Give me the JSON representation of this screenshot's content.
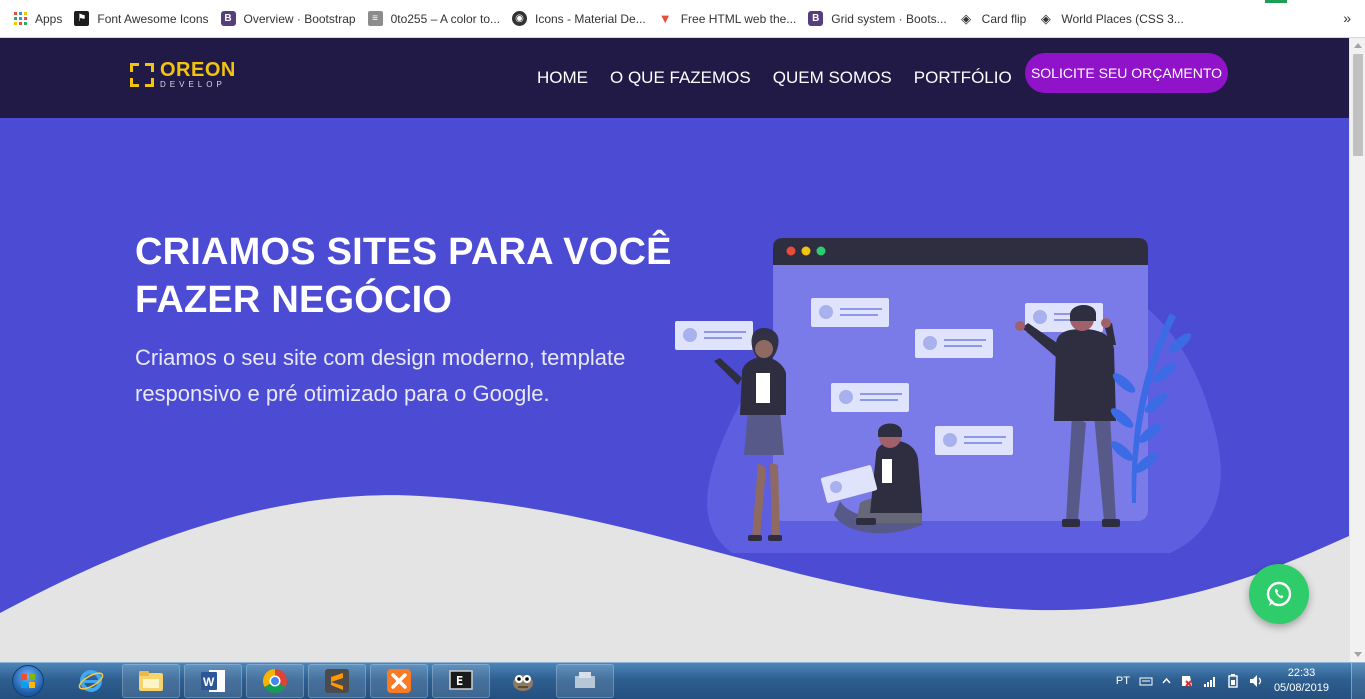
{
  "bookmarks": [
    {
      "label": "Apps",
      "icon": "apps-icon"
    },
    {
      "label": "Font Awesome Icons",
      "icon": "font-awesome-icon"
    },
    {
      "label": "Overview · Bootstrap",
      "icon": "bootstrap-icon"
    },
    {
      "label": "0to255 – A color to...",
      "icon": "page-icon"
    },
    {
      "label": "Icons - Material De...",
      "icon": "material-icon"
    },
    {
      "label": "Free HTML web the...",
      "icon": "free-html-icon"
    },
    {
      "label": "Grid system · Boots...",
      "icon": "bootstrap-icon"
    },
    {
      "label": "Card flip",
      "icon": "codepen-icon"
    },
    {
      "label": "World Places (CSS 3...",
      "icon": "codepen-icon"
    }
  ],
  "more_bookmarks": "»",
  "logo": {
    "name": "OREON",
    "sub": "DEVELOP"
  },
  "nav": [
    "HOME",
    "O QUE FAZEMOS",
    "QUEM SOMOS",
    "PORTFÓLIO"
  ],
  "cta_label": "SOLICITE SEU ORÇAMENTO",
  "hero": {
    "title": "CRIAMOS SITES PARA VOCÊ FAZER NEGÓCIO",
    "subtitle": "Criamos o seu site com design moderno, template responsivo e pré otimizado para o Google."
  },
  "colors": {
    "header": "#221a46",
    "hero": "#4c4bd4",
    "cta": "#9013c9",
    "whatsapp": "#2ecc6a",
    "logo": "#f1c40f"
  },
  "taskbar": {
    "language": "PT",
    "time": "22:33",
    "date": "05/08/2019",
    "apps": [
      "ie-icon",
      "explorer-icon",
      "word-icon",
      "chrome-icon",
      "sublime-icon",
      "xampp-icon",
      "terminal-icon",
      "gimp-icon",
      "app-icon"
    ]
  }
}
